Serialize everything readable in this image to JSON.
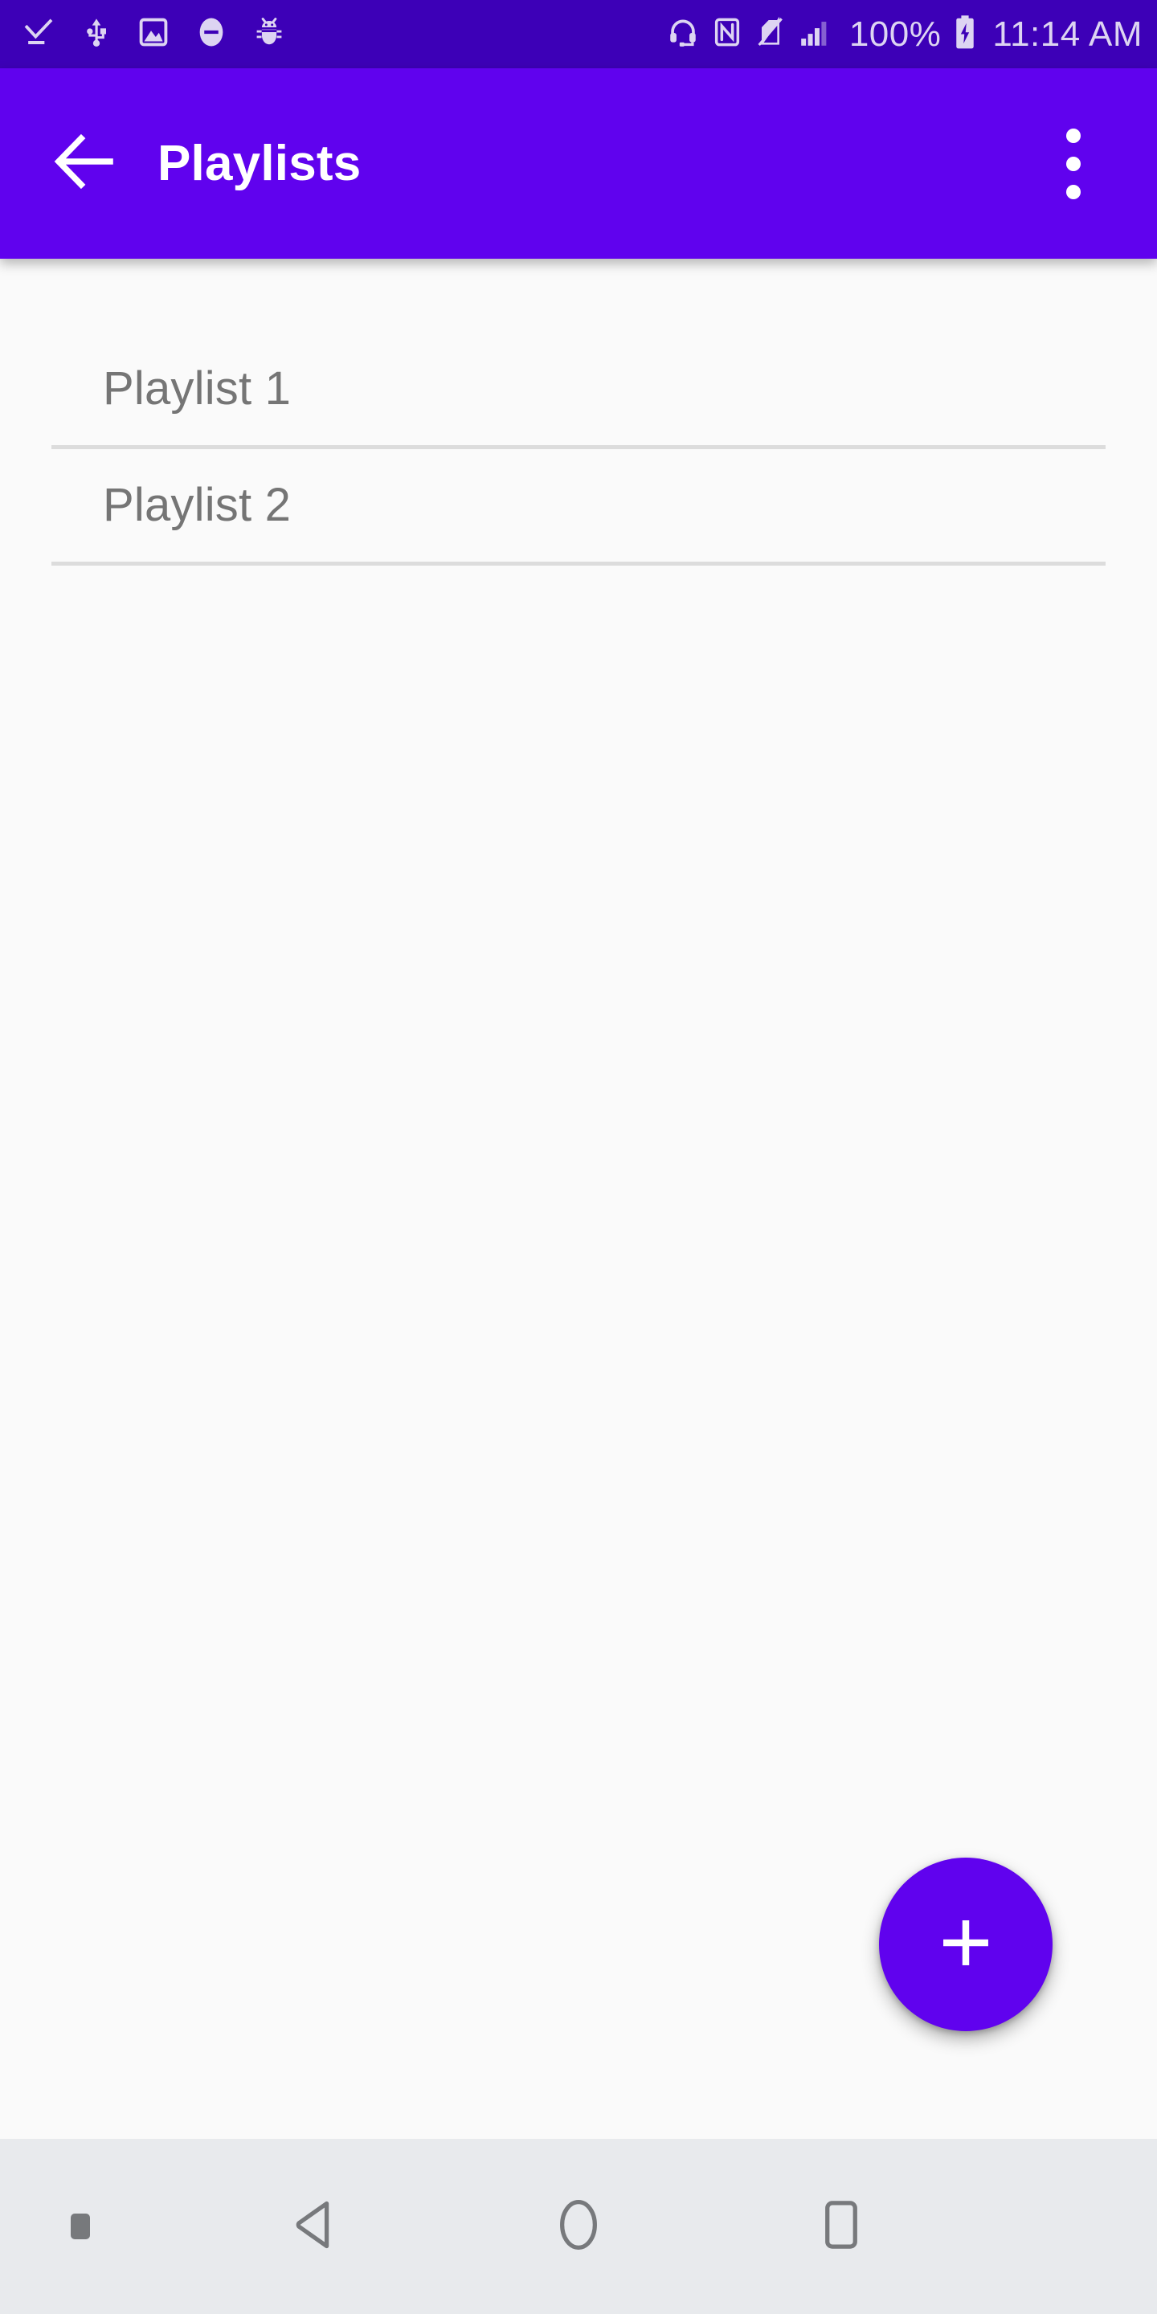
{
  "status_bar": {
    "background_color": "#3d00b7",
    "icon_color": "#ddd4f2",
    "left_icons": [
      {
        "name": "checkmark-download-icon",
        "label": "Download complete"
      },
      {
        "name": "usb-icon",
        "label": "USB connected"
      },
      {
        "name": "screenshot-image-icon",
        "label": "Screenshot captured"
      },
      {
        "name": "do-not-disturb-icon",
        "label": "Do not disturb"
      },
      {
        "name": "android-debug-bug-icon",
        "label": "USB debugging"
      }
    ],
    "right_icons": [
      {
        "name": "headset-icon",
        "label": "Headset connected"
      },
      {
        "name": "nfc-icon",
        "label": "NFC enabled"
      },
      {
        "name": "no-sim-icon",
        "label": "No SIM card"
      },
      {
        "name": "signal-bars-icon",
        "label": "Signal strength"
      },
      {
        "name": "battery-charging-icon",
        "label": "Battery charging"
      }
    ],
    "battery_percent": "100%",
    "clock": "11:14 AM"
  },
  "app_bar": {
    "background_color": "#6002ee",
    "title": "Playlists",
    "back_icon": "arrow-back-icon",
    "overflow_icon": "more-vert-icon"
  },
  "content": {
    "background_color": "#fafafa",
    "text_color": "#757575",
    "divider_color": "#dcdcdc",
    "playlists": [
      {
        "label": "Playlist 1"
      },
      {
        "label": "Playlist 2"
      }
    ]
  },
  "fab": {
    "icon": "add-plus-icon",
    "label": "+",
    "background_color": "#6002ee",
    "icon_color": "#ffffff"
  },
  "nav_bar": {
    "background_color": "#e8eaed",
    "icon_color": "#77797c",
    "items": [
      {
        "name": "ime-switcher-dot",
        "label": "Keyboard switcher"
      },
      {
        "name": "nav-back-icon",
        "label": "Back"
      },
      {
        "name": "nav-home-icon",
        "label": "Home"
      },
      {
        "name": "nav-recents-icon",
        "label": "Recents"
      }
    ]
  }
}
